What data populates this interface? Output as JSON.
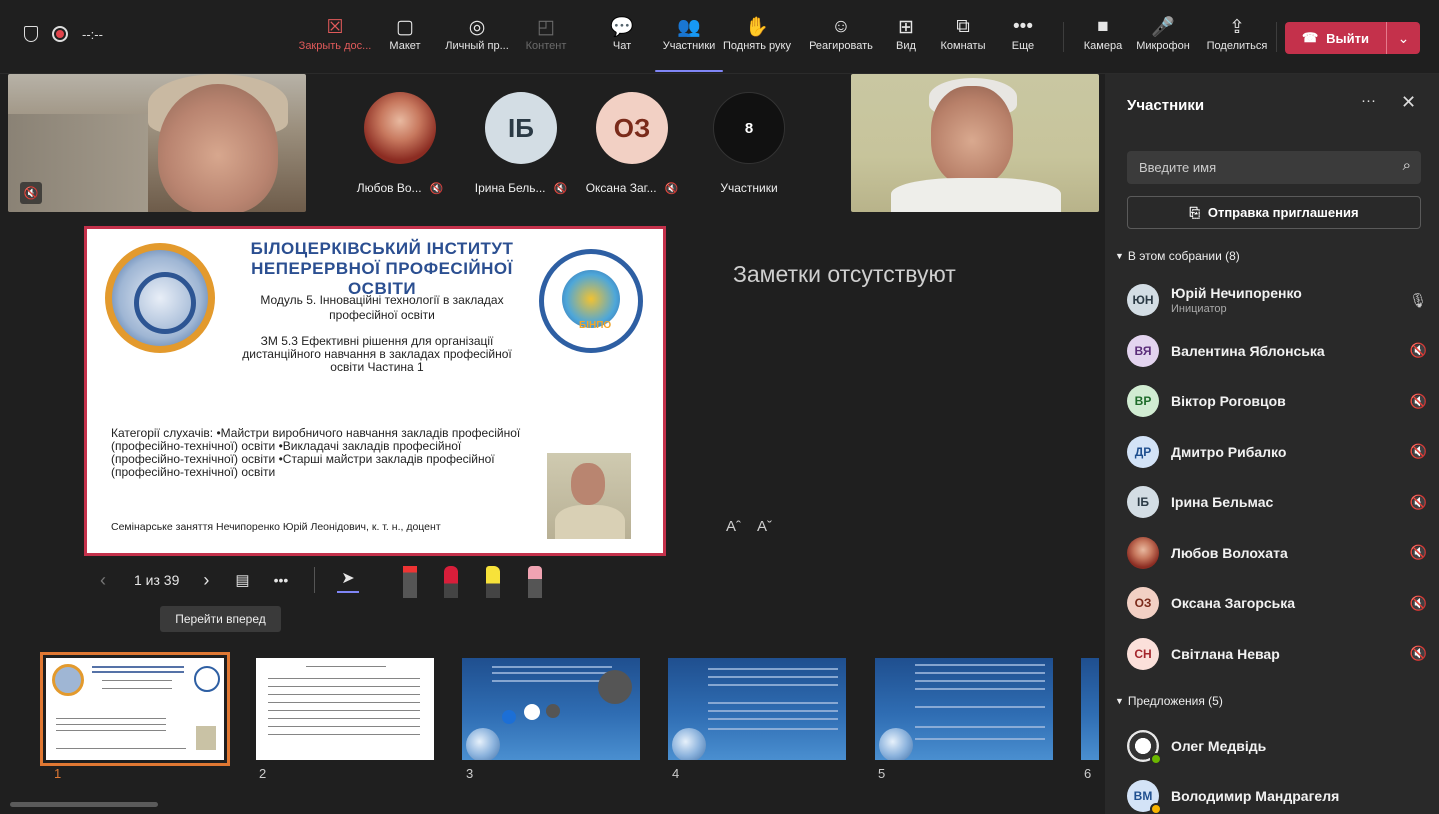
{
  "topbar": {
    "timer": "--:--",
    "buttons": [
      {
        "id": "close",
        "label": "Закрыть дос...",
        "icon": "close-share-icon",
        "state": "red",
        "glyph": "☒"
      },
      {
        "id": "layout",
        "label": "Макет",
        "icon": "layout-icon",
        "glyph": "▢"
      },
      {
        "id": "immersive",
        "label": "Личный пр...",
        "icon": "immersive-icon",
        "glyph": "◎"
      },
      {
        "id": "content",
        "label": "Контент",
        "icon": "content-icon",
        "state": "disabled",
        "glyph": "◰"
      },
      {
        "id": "chat",
        "label": "Чат",
        "icon": "chat-icon",
        "glyph": "💬"
      },
      {
        "id": "participants",
        "label": "Участники",
        "icon": "participants-icon",
        "state": "active",
        "glyph": "👥"
      },
      {
        "id": "hand",
        "label": "Поднять руку",
        "icon": "raise-hand-icon",
        "glyph": "✋"
      },
      {
        "id": "react",
        "label": "Реагировать",
        "icon": "react-icon",
        "glyph": "☺"
      },
      {
        "id": "view",
        "label": "Вид",
        "icon": "view-icon",
        "glyph": "⊞"
      },
      {
        "id": "rooms",
        "label": "Комнаты",
        "icon": "rooms-icon",
        "glyph": "⧉"
      },
      {
        "id": "more",
        "label": "Еще",
        "icon": "more-icon",
        "glyph": "•••"
      },
      {
        "id": "camera",
        "label": "Камера",
        "icon": "camera-icon",
        "glyph": "■"
      },
      {
        "id": "mic",
        "label": "Микрофон",
        "icon": "microphone-icon",
        "glyph": "🎤"
      },
      {
        "id": "share",
        "label": "Поделиться",
        "icon": "share-icon",
        "glyph": "⇪"
      }
    ],
    "leave_label": "Выйти"
  },
  "tiles": [
    {
      "name": "Любов Во...",
      "initials": "",
      "color": "#b04a3a"
    },
    {
      "name": "Ірина Бель...",
      "initials": "ІБ",
      "color": "#d3dde4",
      "text": "#2b3a45"
    },
    {
      "name": "Оксана Заг...",
      "initials": "ОЗ",
      "color": "#f2d0c4",
      "text": "#7a2a1a"
    },
    {
      "name": "Участники",
      "initials": "8",
      "color": "#111111",
      "text": "#ffffff"
    }
  ],
  "slide": {
    "title": "БІЛОЦЕРКІВСЬКИЙ ІНСТИТУТ НЕПЕРЕРВНОЇ ПРОФЕСІЙНОЇ ОСВІТИ",
    "module": "Модуль 5. Інноваційні технології в закладах професійної освіти",
    "zm": "ЗМ 5.3 Ефективні рішення для організації дистанційного навчання в закладах професійної освіти Частина 1",
    "categories": "Категорії слухачів: •Майстри виробничого навчання закладів професійної (професійно-технічної) освіти •Викладачі закладів професійної (професійно-технічної) освіти •Старші майстри закладів професійної (професійно-технічної) освіти",
    "footer": "Семінарське заняття    Нечипоренко Юрій Леонідович, к. т. н., доцент",
    "logo_label": "БІНПО"
  },
  "notes": "Заметки отсутствуют",
  "slide_nav": {
    "counter": "1 из 39",
    "tooltip": "Перейти вперед"
  },
  "thumbnails": [
    "1",
    "2",
    "3",
    "4",
    "5",
    "6"
  ],
  "panel": {
    "title": "Участники",
    "search_placeholder": "Введите имя",
    "invite_label": "Отправка приглашения",
    "in_meeting": "В этом собрании (8)",
    "suggestions": "Предложения (5)",
    "participants": [
      {
        "initials": "ЮН",
        "name": "Юрій Нечипоренко",
        "role": "Инициатор",
        "bg": "#d3dde4",
        "fg": "#2b3a45",
        "mic": "on"
      },
      {
        "initials": "ВЯ",
        "name": "Валентина Яблонська",
        "role": "",
        "bg": "#e3d4ef",
        "fg": "#5b2d7a",
        "mic": "off"
      },
      {
        "initials": "ВР",
        "name": "Віктор Роговцов",
        "role": "",
        "bg": "#d1ecd2",
        "fg": "#1e6b2a",
        "mic": "off"
      },
      {
        "initials": "ДР",
        "name": "Дмитро Рибалко",
        "role": "",
        "bg": "#d3e3f7",
        "fg": "#1f4f8f",
        "mic": "off"
      },
      {
        "initials": "ІБ",
        "name": "Ірина Бельмас",
        "role": "",
        "bg": "#d3dde4",
        "fg": "#2b3a45",
        "mic": "off"
      },
      {
        "initials": "",
        "name": "Любов Волохата",
        "role": "",
        "bg": "#b04a3a",
        "fg": "#fff",
        "mic": "off"
      },
      {
        "initials": "ОЗ",
        "name": "Оксана Загорська",
        "role": "",
        "bg": "#f2d0c4",
        "fg": "#7a2a1a",
        "mic": "off"
      },
      {
        "initials": "СН",
        "name": "Світлана Невар",
        "role": "",
        "bg": "#fbe0da",
        "fg": "#a4262c",
        "mic": "off"
      }
    ],
    "suggested": [
      {
        "initials": "",
        "name": "Олег Медвідь",
        "bg": "#e8e8e8",
        "fg": "#333",
        "status": "#6bb700"
      },
      {
        "initials": "ВМ",
        "name": "Володимир Мандрагеля",
        "bg": "#d3e3f7",
        "fg": "#1f4f8f",
        "status": "#f8b400"
      }
    ]
  }
}
